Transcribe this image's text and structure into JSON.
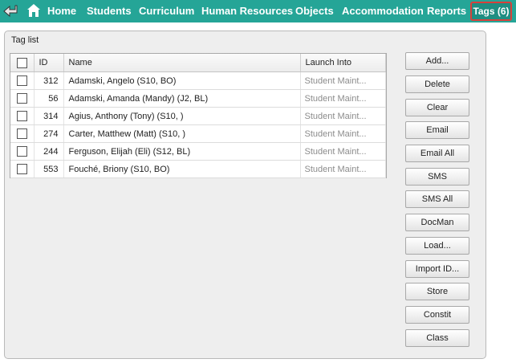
{
  "nav": {
    "back_icon": "back-arrow-icon",
    "home_icon": "home-icon",
    "items": [
      {
        "label": "Home"
      },
      {
        "label": "Students"
      },
      {
        "label": "Curriculum"
      },
      {
        "label": "Human Resources"
      },
      {
        "label": "Objects"
      },
      {
        "label": "Accommodation"
      },
      {
        "label": "Reports"
      }
    ],
    "tags_label": "Tags (6)",
    "colors": {
      "bar": "#25a597",
      "highlight_border": "#d9403a"
    }
  },
  "panel": {
    "title": "Tag list"
  },
  "table": {
    "headers": {
      "id": "ID",
      "name": "Name",
      "launch": "Launch Into"
    },
    "rows": [
      {
        "id": "312",
        "name": "Adamski, Angelo (S10, BO)",
        "launch": "Student Maint..."
      },
      {
        "id": "56",
        "name": "Adamski, Amanda (Mandy) (J2, BL)",
        "launch": "Student Maint..."
      },
      {
        "id": "314",
        "name": "Agius, Anthony (Tony) (S10, )",
        "launch": "Student Maint..."
      },
      {
        "id": "274",
        "name": "Carter, Matthew (Matt) (S10, )",
        "launch": "Student Maint..."
      },
      {
        "id": "244",
        "name": "Ferguson, Elijah (Eli) (S12, BL)",
        "launch": "Student Maint..."
      },
      {
        "id": "553",
        "name": "Fouché, Briony (S10, BO)",
        "launch": "Student Maint..."
      }
    ]
  },
  "buttons": [
    {
      "label": "Add..."
    },
    {
      "label": "Delete"
    },
    {
      "label": "Clear"
    },
    {
      "label": "Email"
    },
    {
      "label": "Email All"
    },
    {
      "label": "SMS"
    },
    {
      "label": "SMS All"
    },
    {
      "label": "DocMan"
    },
    {
      "label": "Load..."
    },
    {
      "label": "Import ID..."
    },
    {
      "label": "Store"
    },
    {
      "label": "Constit"
    },
    {
      "label": "Class"
    }
  ]
}
